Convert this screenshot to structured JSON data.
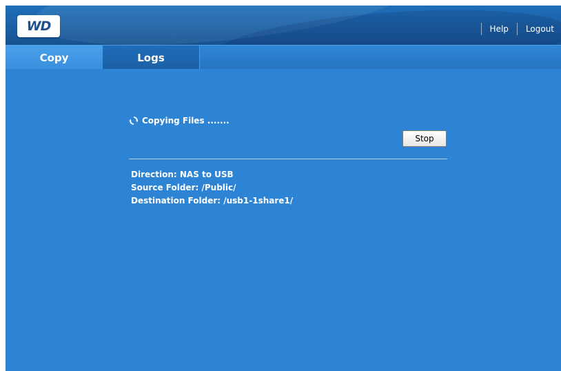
{
  "header": {
    "logo_text": "WD",
    "links": {
      "help": "Help",
      "logout": "Logout"
    }
  },
  "tabs": [
    {
      "label": "Copy",
      "active": true
    },
    {
      "label": "Logs",
      "active": false
    }
  ],
  "status": {
    "icon": "refresh-icon",
    "text": "Copying Files ......."
  },
  "actions": {
    "stop_label": "Stop"
  },
  "info": {
    "direction": "Direction: NAS to USB",
    "source": "Source Folder: /Public/",
    "destination": "Destination Folder: /usb1-1share1/"
  },
  "colors": {
    "background": "#2e84d4",
    "header": "#1b5fa4",
    "active_tab": "#3a8fde",
    "text": "#ffffff"
  }
}
